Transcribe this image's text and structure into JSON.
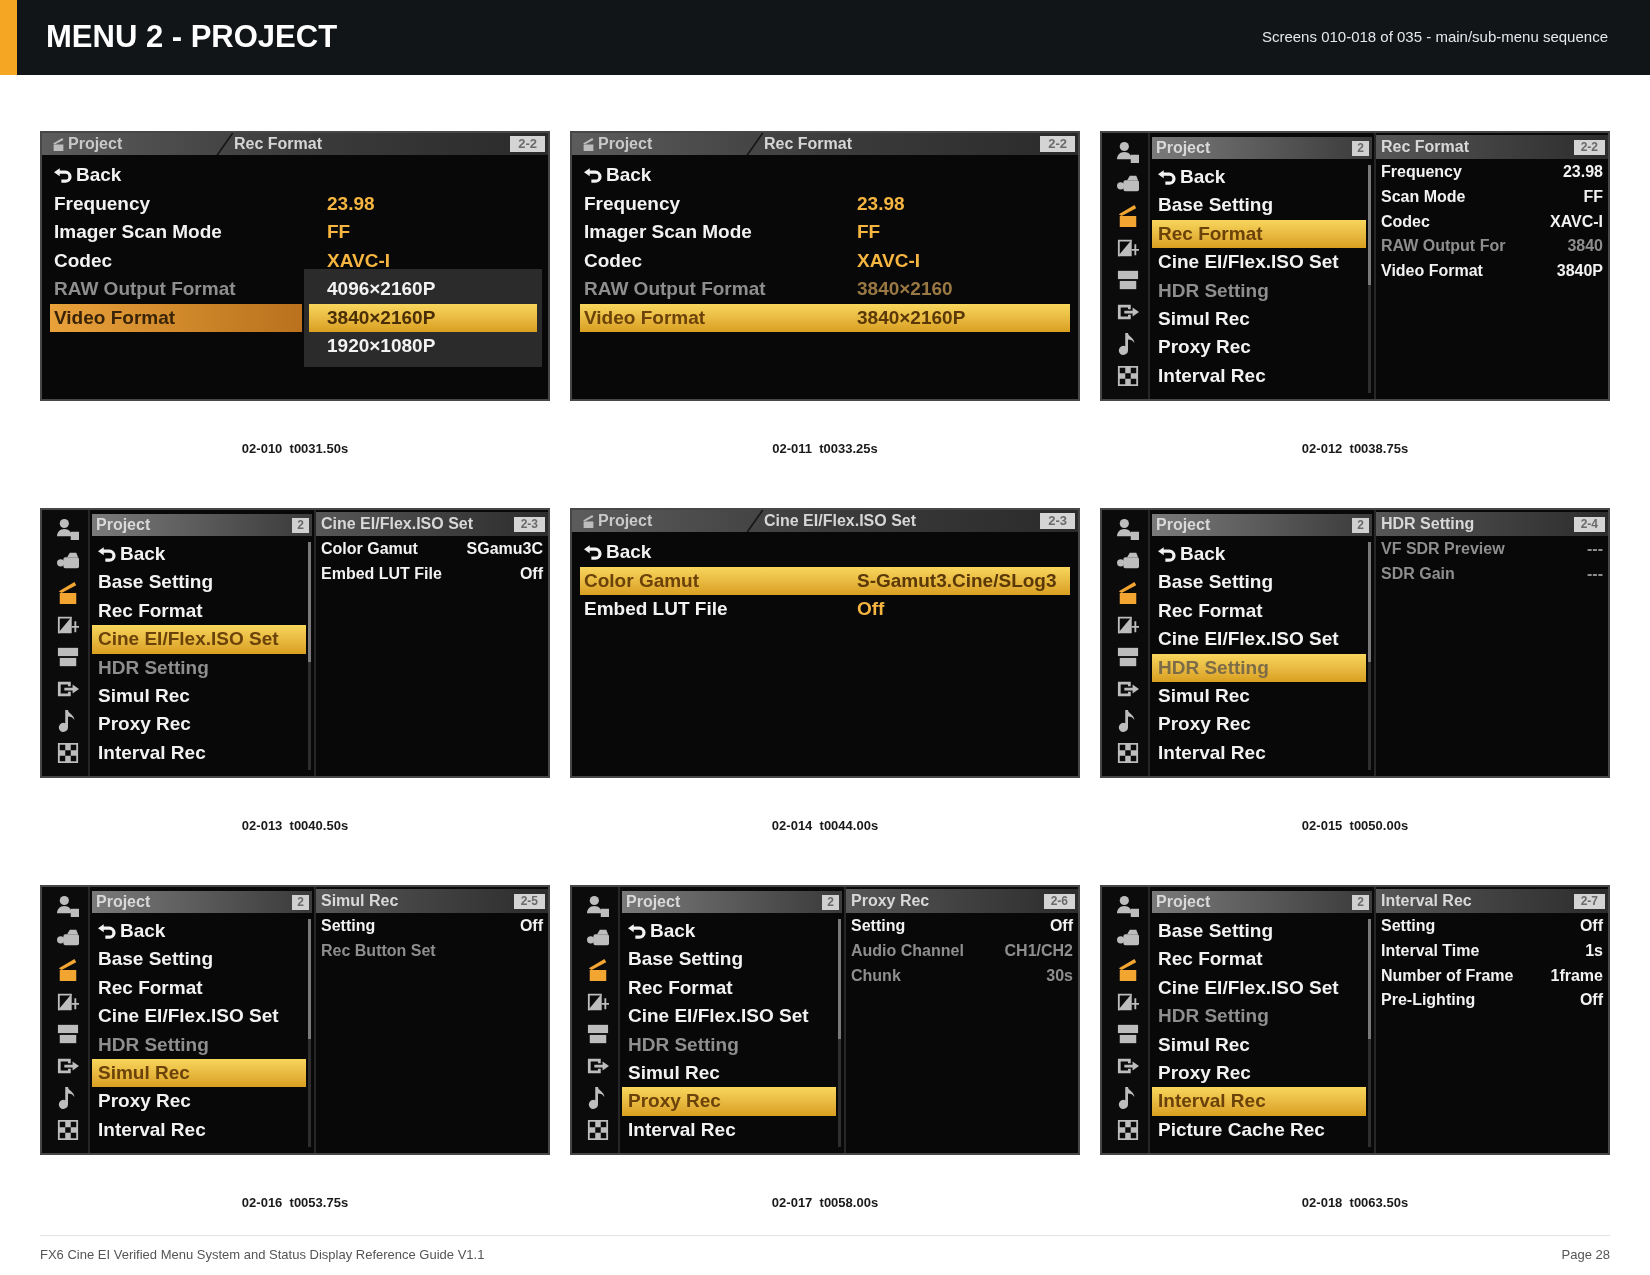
{
  "header": {
    "title": "MENU 2 - PROJECT",
    "subtitle": "Screens 010-018 of 035 - main/sub-menu sequence"
  },
  "screens": [
    {
      "kind": "detail",
      "parent": "Project",
      "title": "Rec Format",
      "page": "2-2",
      "rows": [
        {
          "kind": "back",
          "label": "Back",
          "selected": false,
          "disabled": false
        },
        {
          "kind": "setting",
          "label": "Frequency",
          "value": "23.98",
          "selected": false,
          "disabled": false
        },
        {
          "kind": "setting",
          "label": "Imager Scan Mode",
          "value": "FF",
          "selected": false,
          "disabled": false
        },
        {
          "kind": "setting",
          "label": "Codec",
          "value": "XAVC-I",
          "selected": false,
          "disabled": false
        },
        {
          "kind": "setting",
          "label": "RAW Output Format",
          "selected": false,
          "disabled": true
        },
        {
          "kind": "setting",
          "label": "Video Format",
          "selected": true,
          "disabled": false,
          "dropdown": [
            {
              "label": "4096×2160P",
              "selected": false
            },
            {
              "label": "3840×2160P",
              "selected": true
            },
            {
              "label": "1920×1080P",
              "selected": false
            }
          ]
        }
      ],
      "caption": "02-010  t0031.50s"
    },
    {
      "kind": "detail",
      "parent": "Project",
      "title": "Rec Format",
      "page": "2-2",
      "rows": [
        {
          "kind": "back",
          "label": "Back",
          "selected": false,
          "disabled": false
        },
        {
          "kind": "setting",
          "label": "Frequency",
          "value": "23.98",
          "selected": false,
          "disabled": false
        },
        {
          "kind": "setting",
          "label": "Imager Scan Mode",
          "value": "FF",
          "selected": false,
          "disabled": false
        },
        {
          "kind": "setting",
          "label": "Codec",
          "value": "XAVC-I",
          "selected": false,
          "disabled": false
        },
        {
          "kind": "setting",
          "label": "RAW Output Format",
          "value": "3840×2160",
          "selected": false,
          "disabled": true
        },
        {
          "kind": "setting",
          "label": "Video Format",
          "value": "3840×2160P",
          "selected": true,
          "disabled": false
        }
      ],
      "caption": "02-011  t0033.25s"
    },
    {
      "kind": "split",
      "side_tabs": [
        {
          "selected": false
        },
        {
          "selected": false
        },
        {
          "selected": true
        },
        {
          "selected": false
        },
        {
          "selected": false
        },
        {
          "selected": false
        },
        {
          "selected": false
        },
        {
          "selected": false
        }
      ],
      "menu": {
        "title": "Project",
        "page": "2",
        "items": [
          {
            "kind": "back",
            "label": "Back",
            "selected": false,
            "disabled": false
          },
          {
            "kind": "item",
            "label": "Base Setting",
            "selected": false,
            "disabled": false
          },
          {
            "kind": "item",
            "label": "Rec Format",
            "selected": true,
            "disabled": false
          },
          {
            "kind": "item",
            "label": "Cine EI/Flex.ISO Set",
            "selected": false,
            "disabled": false
          },
          {
            "kind": "item",
            "label": "HDR Setting",
            "selected": false,
            "disabled": true
          },
          {
            "kind": "item",
            "label": "Simul Rec",
            "selected": false,
            "disabled": false
          },
          {
            "kind": "item",
            "label": "Proxy Rec",
            "selected": false,
            "disabled": false
          },
          {
            "kind": "item",
            "label": "Interval Rec",
            "selected": false,
            "disabled": false
          }
        ]
      },
      "pane": {
        "title": "Rec Format",
        "page": "2-2",
        "rows": [
          {
            "label": "Frequency",
            "value": "23.98",
            "disabled": false
          },
          {
            "label": "Scan Mode",
            "value": "FF",
            "disabled": false
          },
          {
            "label": "Codec",
            "value": "XAVC-I",
            "disabled": false
          },
          {
            "label": "RAW Output For",
            "value": "3840",
            "disabled": true
          },
          {
            "label": "Video Format",
            "value": "3840P",
            "disabled": false
          }
        ]
      },
      "caption": "02-012  t0038.75s"
    },
    {
      "kind": "split",
      "side_tabs": [
        {
          "selected": false
        },
        {
          "selected": false
        },
        {
          "selected": true
        },
        {
          "selected": false
        },
        {
          "selected": false
        },
        {
          "selected": false
        },
        {
          "selected": false
        },
        {
          "selected": false
        }
      ],
      "menu": {
        "title": "Project",
        "page": "2",
        "items": [
          {
            "kind": "back",
            "label": "Back",
            "selected": false,
            "disabled": false
          },
          {
            "kind": "item",
            "label": "Base Setting",
            "selected": false,
            "disabled": false
          },
          {
            "kind": "item",
            "label": "Rec Format",
            "selected": false,
            "disabled": false
          },
          {
            "kind": "item",
            "label": "Cine EI/Flex.ISO Set",
            "selected": true,
            "disabled": false
          },
          {
            "kind": "item",
            "label": "HDR Setting",
            "selected": false,
            "disabled": true
          },
          {
            "kind": "item",
            "label": "Simul Rec",
            "selected": false,
            "disabled": false
          },
          {
            "kind": "item",
            "label": "Proxy Rec",
            "selected": false,
            "disabled": false
          },
          {
            "kind": "item",
            "label": "Interval Rec",
            "selected": false,
            "disabled": false
          }
        ]
      },
      "pane": {
        "title": "Cine EI/Flex.ISO Set",
        "page": "2-3",
        "rows": [
          {
            "label": "Color Gamut",
            "value": "SGamu3C",
            "disabled": false
          },
          {
            "label": "Embed LUT File",
            "value": "Off",
            "disabled": false
          }
        ]
      },
      "caption": "02-013  t0040.50s"
    },
    {
      "kind": "detail",
      "parent": "Project",
      "title": "Cine EI/Flex.ISO Set",
      "page": "2-3",
      "rows": [
        {
          "kind": "back",
          "label": "Back",
          "selected": false,
          "disabled": false
        },
        {
          "kind": "setting",
          "label": "Color Gamut",
          "value": "S-Gamut3.Cine/SLog3",
          "selected": true,
          "disabled": false
        },
        {
          "kind": "setting",
          "label": "Embed LUT File",
          "value": "Off",
          "selected": false,
          "disabled": false
        }
      ],
      "caption": "02-014  t0044.00s"
    },
    {
      "kind": "split",
      "side_tabs": [
        {
          "selected": false
        },
        {
          "selected": false
        },
        {
          "selected": true
        },
        {
          "selected": false
        },
        {
          "selected": false
        },
        {
          "selected": false
        },
        {
          "selected": false
        },
        {
          "selected": false
        }
      ],
      "menu": {
        "title": "Project",
        "page": "2",
        "items": [
          {
            "kind": "back",
            "label": "Back",
            "selected": false,
            "disabled": false
          },
          {
            "kind": "item",
            "label": "Base Setting",
            "selected": false,
            "disabled": false
          },
          {
            "kind": "item",
            "label": "Rec Format",
            "selected": false,
            "disabled": false
          },
          {
            "kind": "item",
            "label": "Cine EI/Flex.ISO Set",
            "selected": false,
            "disabled": false
          },
          {
            "kind": "item",
            "label": "HDR Setting",
            "selected": true,
            "disabled": true
          },
          {
            "kind": "item",
            "label": "Simul Rec",
            "selected": false,
            "disabled": false
          },
          {
            "kind": "item",
            "label": "Proxy Rec",
            "selected": false,
            "disabled": false
          },
          {
            "kind": "item",
            "label": "Interval Rec",
            "selected": false,
            "disabled": false
          }
        ]
      },
      "pane": {
        "title": "HDR Setting",
        "page": "2-4",
        "rows": [
          {
            "label": "VF SDR Preview",
            "value": "---",
            "disabled": true
          },
          {
            "label": "SDR Gain",
            "value": "---",
            "disabled": true
          }
        ]
      },
      "caption": "02-015  t0050.00s"
    },
    {
      "kind": "split",
      "side_tabs": [
        {
          "selected": false
        },
        {
          "selected": false
        },
        {
          "selected": true
        },
        {
          "selected": false
        },
        {
          "selected": false
        },
        {
          "selected": false
        },
        {
          "selected": false
        },
        {
          "selected": false
        }
      ],
      "menu": {
        "title": "Project",
        "page": "2",
        "items": [
          {
            "kind": "back",
            "label": "Back",
            "selected": false,
            "disabled": false
          },
          {
            "kind": "item",
            "label": "Base Setting",
            "selected": false,
            "disabled": false
          },
          {
            "kind": "item",
            "label": "Rec Format",
            "selected": false,
            "disabled": false
          },
          {
            "kind": "item",
            "label": "Cine EI/Flex.ISO Set",
            "selected": false,
            "disabled": false
          },
          {
            "kind": "item",
            "label": "HDR Setting",
            "selected": false,
            "disabled": true
          },
          {
            "kind": "item",
            "label": "Simul Rec",
            "selected": true,
            "disabled": false
          },
          {
            "kind": "item",
            "label": "Proxy Rec",
            "selected": false,
            "disabled": false
          },
          {
            "kind": "item",
            "label": "Interval Rec",
            "selected": false,
            "disabled": false
          }
        ]
      },
      "pane": {
        "title": "Simul Rec",
        "page": "2-5",
        "rows": [
          {
            "label": "Setting",
            "value": "Off",
            "disabled": false
          },
          {
            "label": "Rec Button Set",
            "disabled": true
          }
        ]
      },
      "caption": "02-016  t0053.75s"
    },
    {
      "kind": "split",
      "side_tabs": [
        {
          "selected": false
        },
        {
          "selected": false
        },
        {
          "selected": true
        },
        {
          "selected": false
        },
        {
          "selected": false
        },
        {
          "selected": false
        },
        {
          "selected": false
        },
        {
          "selected": false
        }
      ],
      "menu": {
        "title": "Project",
        "page": "2",
        "items": [
          {
            "kind": "back",
            "label": "Back",
            "selected": false,
            "disabled": false
          },
          {
            "kind": "item",
            "label": "Base Setting",
            "selected": false,
            "disabled": false
          },
          {
            "kind": "item",
            "label": "Rec Format",
            "selected": false,
            "disabled": false
          },
          {
            "kind": "item",
            "label": "Cine EI/Flex.ISO Set",
            "selected": false,
            "disabled": false
          },
          {
            "kind": "item",
            "label": "HDR Setting",
            "selected": false,
            "disabled": true
          },
          {
            "kind": "item",
            "label": "Simul Rec",
            "selected": false,
            "disabled": false
          },
          {
            "kind": "item",
            "label": "Proxy Rec",
            "selected": true,
            "disabled": false
          },
          {
            "kind": "item",
            "label": "Interval Rec",
            "selected": false,
            "disabled": false
          }
        ]
      },
      "pane": {
        "title": "Proxy Rec",
        "page": "2-6",
        "rows": [
          {
            "label": "Setting",
            "value": "Off",
            "disabled": false
          },
          {
            "label": "Audio Channel",
            "value": "CH1/CH2",
            "disabled": true
          },
          {
            "label": "Chunk",
            "value": "30s",
            "disabled": true
          }
        ]
      },
      "caption": "02-017  t0058.00s"
    },
    {
      "kind": "split",
      "side_tabs": [
        {
          "selected": false
        },
        {
          "selected": false
        },
        {
          "selected": true
        },
        {
          "selected": false
        },
        {
          "selected": false
        },
        {
          "selected": false
        },
        {
          "selected": false
        },
        {
          "selected": false
        }
      ],
      "menu": {
        "title": "Project",
        "page": "2",
        "items": [
          {
            "kind": "item",
            "label": "Base Setting",
            "selected": false,
            "disabled": false
          },
          {
            "kind": "item",
            "label": "Rec Format",
            "selected": false,
            "disabled": false
          },
          {
            "kind": "item",
            "label": "Cine EI/Flex.ISO Set",
            "selected": false,
            "disabled": false
          },
          {
            "kind": "item",
            "label": "HDR Setting",
            "selected": false,
            "disabled": true
          },
          {
            "kind": "item",
            "label": "Simul Rec",
            "selected": false,
            "disabled": false
          },
          {
            "kind": "item",
            "label": "Proxy Rec",
            "selected": false,
            "disabled": false
          },
          {
            "kind": "item",
            "label": "Interval Rec",
            "selected": true,
            "disabled": false
          },
          {
            "kind": "item",
            "label": "Picture Cache Rec",
            "selected": false,
            "disabled": false
          }
        ]
      },
      "pane": {
        "title": "Interval Rec",
        "page": "2-7",
        "rows": [
          {
            "label": "Setting",
            "value": "Off",
            "disabled": false
          },
          {
            "label": "Interval Time",
            "value": "1s",
            "disabled": false
          },
          {
            "label": "Number of Frame",
            "value": "1frame",
            "disabled": false
          },
          {
            "label": "Pre-Lighting",
            "value": "Off",
            "disabled": false
          }
        ]
      },
      "caption": "02-018  t0063.50s"
    }
  ],
  "footer": {
    "text": "FX6 Cine EI Verified Menu System and Status Display Reference Guide V1.1",
    "page": "Page 28"
  }
}
